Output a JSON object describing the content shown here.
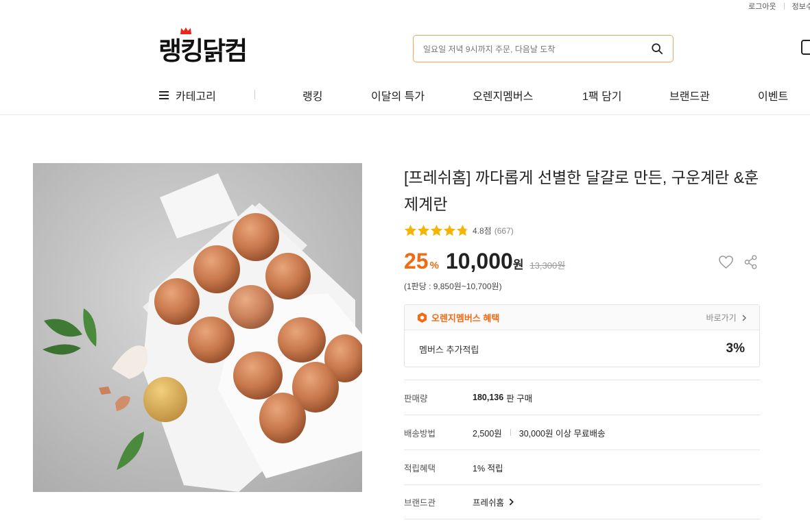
{
  "utility": {
    "logout": "로그아웃",
    "info": "정보수"
  },
  "brand": {
    "logo": "랭킹닭컴"
  },
  "search": {
    "placeholder": "일요일 저녁 9시까지 주문, 다음날 도착"
  },
  "nav": {
    "category": "카테고리",
    "items": [
      "랭킹",
      "이달의 특가",
      "오렌지멤버스",
      "1팩 담기",
      "브랜드관",
      "이벤트"
    ]
  },
  "product": {
    "title": "[프레쉬홈] 까다롭게 선별한 달걀로 만든, 구운계란 &훈제계란",
    "rating": "4.8점",
    "review_count": "(667)",
    "stars_filled": 4.8,
    "discount": "25",
    "discount_unit": "%",
    "price": "10,000",
    "price_unit": "원",
    "original_price": "13,300원",
    "per_pack": "(1판당 : 9,850원~10,700원)"
  },
  "membership": {
    "title": "오렌지멤버스 혜택",
    "link": "바로가기",
    "label": "멤버스 추가적립",
    "value": "3%"
  },
  "specs": {
    "sales_label": "판매량",
    "sales_value": "180,136",
    "sales_suffix": "판 구매",
    "shipping_label": "배송방법",
    "shipping_fee": "2,500원",
    "shipping_free": "30,000원 이상 무료배송",
    "points_label": "적립혜택",
    "points_value": "1% 적립",
    "brand_label": "브랜드관",
    "brand_value": "프레쉬홈"
  },
  "colors": {
    "accent": "#f26b12",
    "search_border": "#f0a85a",
    "star": "#f5b400"
  },
  "icons": [
    "search-icon",
    "cart-icon",
    "menu-icon",
    "star-icon",
    "heart-icon",
    "share-icon",
    "membership-badge-icon",
    "chevron-right-icon"
  ]
}
